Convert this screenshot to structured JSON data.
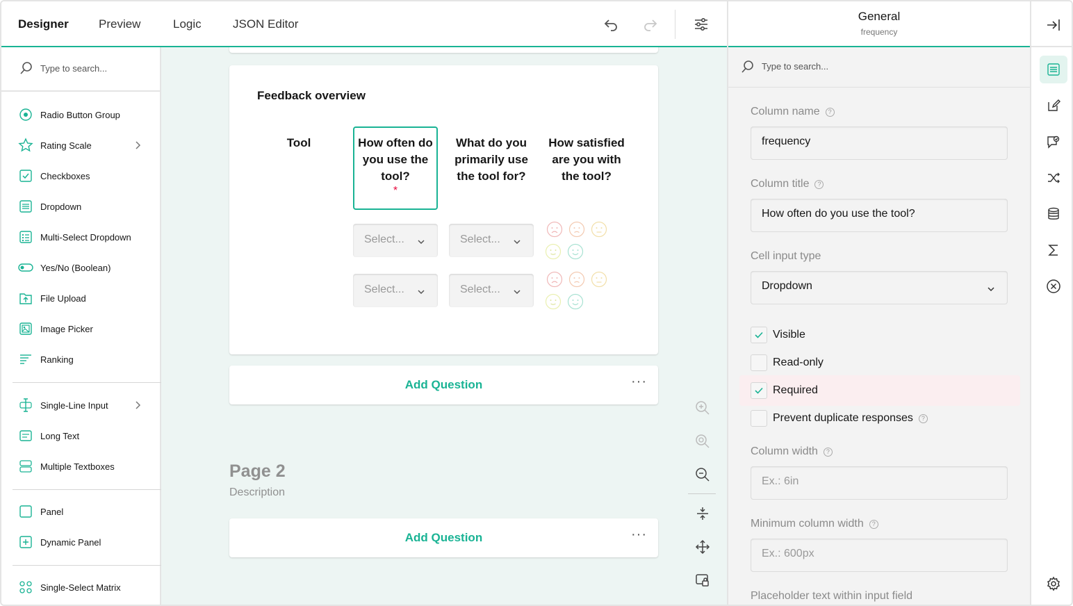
{
  "top_tabs": [
    {
      "label": "Designer"
    },
    {
      "label": "Preview"
    },
    {
      "label": "Logic"
    },
    {
      "label": "JSON Editor"
    }
  ],
  "toolbar_icons": [
    "undo-icon",
    "redo-icon",
    "settings-sliders-icon"
  ],
  "toolbox": {
    "search_placeholder": "Type to search...",
    "items": [
      {
        "label": "Radio Button Group",
        "icon": "radio-icon"
      },
      {
        "label": "Rating Scale",
        "icon": "star-icon",
        "has_submenu": true
      },
      {
        "label": "Checkboxes",
        "icon": "checkbox-icon"
      },
      {
        "label": "Dropdown",
        "icon": "dropdown-icon"
      },
      {
        "label": "Multi-Select Dropdown",
        "icon": "multi-dropdown-icon"
      },
      {
        "label": "Yes/No (Boolean)",
        "icon": "toggle-icon"
      },
      {
        "label": "File Upload",
        "icon": "file-upload-icon"
      },
      {
        "label": "Image Picker",
        "icon": "image-icon"
      },
      {
        "label": "Ranking",
        "icon": "ranking-icon"
      },
      {
        "label": "Single-Line Input",
        "icon": "text-cursor-icon",
        "has_submenu": true
      },
      {
        "label": "Long Text",
        "icon": "long-text-icon"
      },
      {
        "label": "Multiple Textboxes",
        "icon": "multi-text-icon"
      },
      {
        "label": "Panel",
        "icon": "panel-icon"
      },
      {
        "label": "Dynamic Panel",
        "icon": "dynamic-panel-icon"
      },
      {
        "label": "Single-Select Matrix",
        "icon": "matrix-icon"
      }
    ]
  },
  "canvas": {
    "question": {
      "title": "Feedback overview",
      "columns": [
        {
          "header": "Tool"
        },
        {
          "header": "How often do you use the tool?",
          "required_mark": "*"
        },
        {
          "header": "What do you primarily use the tool for?"
        },
        {
          "header": "How satisfied are you with the tool?"
        }
      ],
      "select_placeholder": "Select..."
    },
    "add_question_label": "Add Question",
    "more_label": "···",
    "page2": {
      "title": "Page 2",
      "description": "Description"
    },
    "zoom_icons": [
      "zoom-in-icon",
      "zoom-reset-icon",
      "zoom-out-icon",
      "collapse-icon",
      "move-icon",
      "lock-icon"
    ]
  },
  "properties": {
    "header_title": "General",
    "header_subtitle": "frequency",
    "search_placeholder": "Type to search...",
    "column_name_label": "Column name",
    "column_name_value": "frequency",
    "column_title_label": "Column title",
    "column_title_value": "How often do you use the tool?",
    "cell_input_type_label": "Cell input type",
    "cell_input_type_value": "Dropdown",
    "checks": [
      {
        "label": "Visible",
        "checked": true
      },
      {
        "label": "Read-only",
        "checked": false
      },
      {
        "label": "Required",
        "checked": true
      },
      {
        "label": "Prevent duplicate responses",
        "checked": false
      }
    ],
    "column_width_label": "Column width",
    "column_width_placeholder": "Ex.: 6in",
    "min_column_width_label": "Minimum column width",
    "min_column_width_placeholder": "Ex.: 600px",
    "placeholder_text_label": "Placeholder text within input field"
  },
  "sidebar_icons": [
    "collapse-panel-icon",
    "general-icon",
    "edit-icon",
    "validation-icon",
    "logic-icon",
    "data-icon",
    "totals-icon",
    "close-circle-icon",
    "gear-icon"
  ],
  "colors": {
    "accent": "#19b394",
    "required": "#e60a3e",
    "canvas_bg": "#edf5f3"
  }
}
